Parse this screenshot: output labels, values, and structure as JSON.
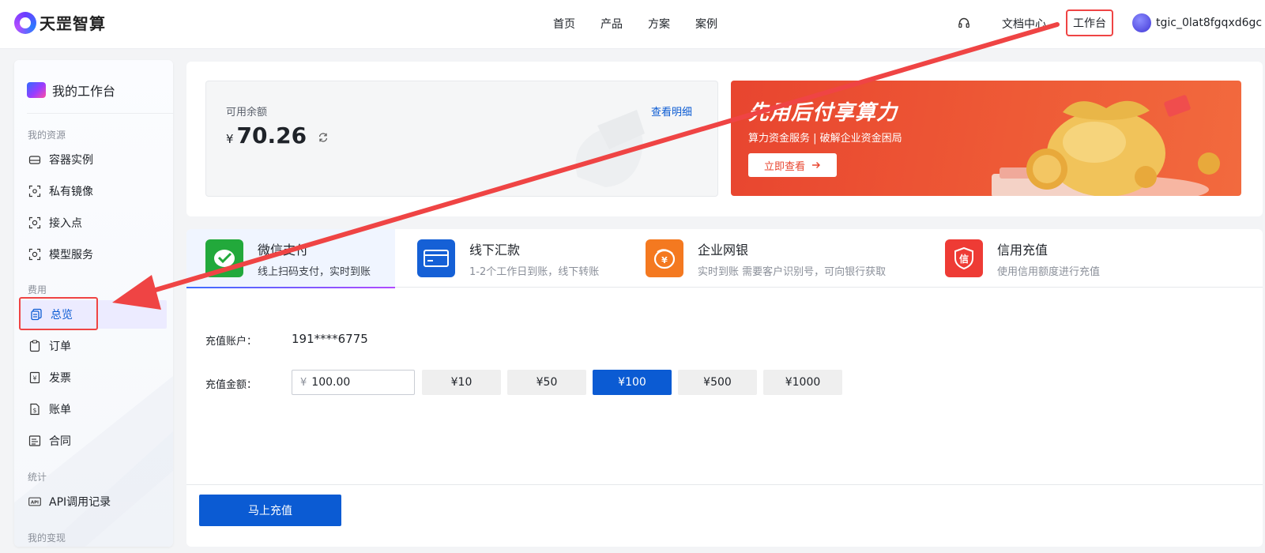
{
  "header": {
    "brand": "天罡智算",
    "nav": [
      "首页",
      "产品",
      "方案",
      "案例"
    ],
    "doc_center": "文档中心",
    "workbench": "工作台",
    "username": "tgic_0lat8fgqxd6gc"
  },
  "sidebar": {
    "title": "我的工作台",
    "groups": {
      "resources": "我的资源",
      "billing": "费用",
      "stats": "统计",
      "earnings": "我的变现"
    },
    "items": {
      "container": "容器实例",
      "image": "私有镜像",
      "endpoint": "接入点",
      "model": "模型服务",
      "overview": "总览",
      "orders": "订单",
      "invoice": "发票",
      "bills": "账单",
      "contracts": "合同",
      "api_log": "API调用记录"
    }
  },
  "balance": {
    "label": "可用余额",
    "currency": "¥",
    "amount": "70.26",
    "detail_link": "查看明细"
  },
  "banner": {
    "headline": "先用后付享算力",
    "subtitle": "算力资金服务 | 破解企业资金困局",
    "button": "立即查看"
  },
  "pay_tabs": [
    {
      "title": "微信支付",
      "desc": "线上扫码支付，实时到账"
    },
    {
      "title": "线下汇款",
      "desc": "1-2个工作日到账，线下转账"
    },
    {
      "title": "企业网银",
      "desc": "实时到账  需要客户识别号，可向银行获取"
    },
    {
      "title": "信用充值",
      "desc": "使用信用额度进行充值"
    }
  ],
  "recharge": {
    "account_label": "充值账户：",
    "account_value": "191****6775",
    "amount_label": "充值金额：",
    "input_prefix": "¥",
    "input_value": "100.00",
    "presets": [
      "¥10",
      "¥50",
      "¥100",
      "¥500",
      "¥1000"
    ],
    "selected_preset": "¥100",
    "submit": "马上充值"
  },
  "colors": {
    "primary": "#0b5bd3",
    "annotation": "#ef4444",
    "banner": "#e8452f",
    "wechat": "#22a93b",
    "bank_transfer": "#1560d6",
    "online_bank": "#f47920",
    "credit": "#ee3b35"
  },
  "icons": [
    "headset-icon",
    "refresh-icon",
    "arrow-right-icon",
    "wechat-icon",
    "card-icon",
    "bank-icon",
    "credit-icon"
  ]
}
